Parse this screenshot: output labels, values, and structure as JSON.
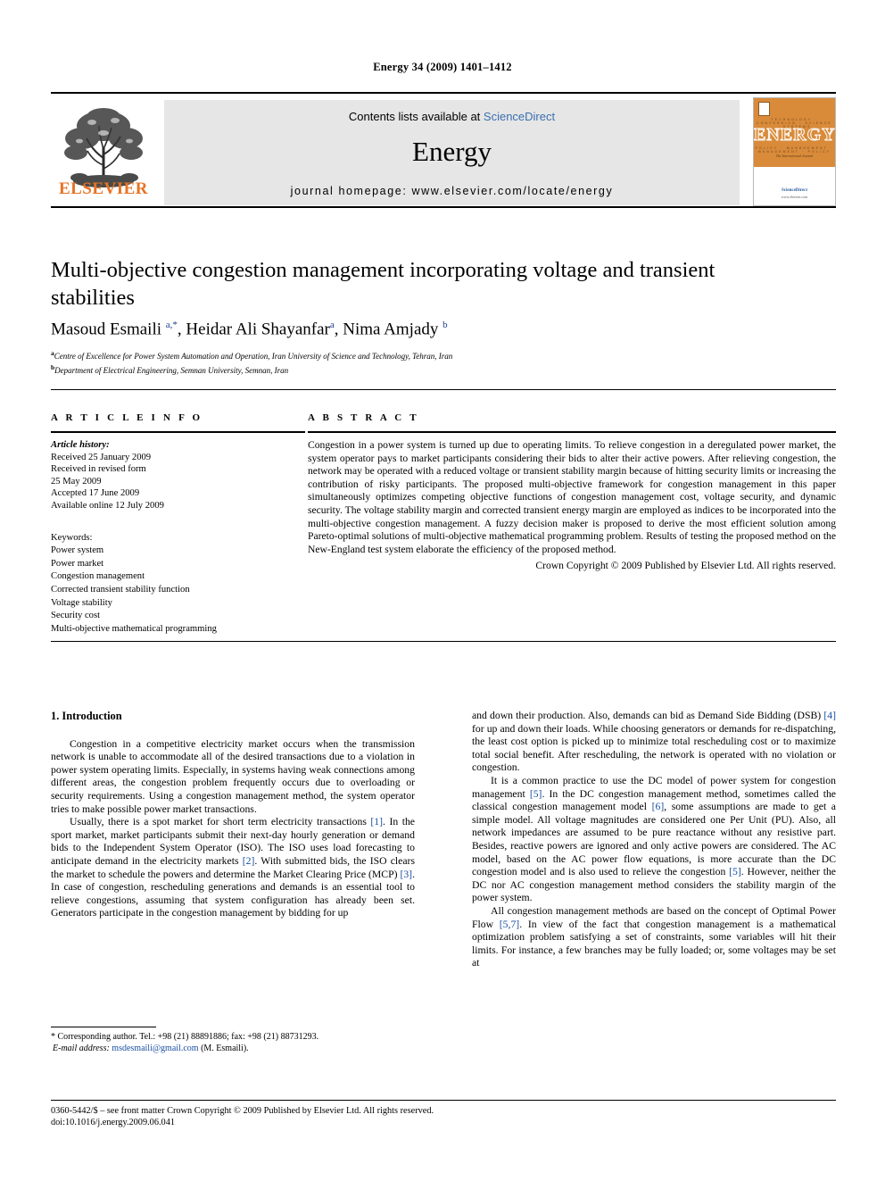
{
  "running_head": "Energy 34 (2009) 1401–1412",
  "masthead": {
    "publisher_name": "ELSEVIER",
    "contents_prefix": "Contents lists available at ",
    "sciencedirect": "ScienceDirect",
    "journal_name": "Energy",
    "homepage": "journal homepage: www.elsevier.com/locate/energy",
    "cover": {
      "title": "ENERGY",
      "row_top": "TECHNOLOGY · CONVERSION · SCIENCE · SYSTEMS",
      "row_bottom": "POLICY · MANAGEMENT · MANAGEMENT · POLICY",
      "subtitle": "The International Journal",
      "available_at": "Available online at",
      "sd_mark": "ScienceDirect",
      "url": "www.elsevier.com"
    }
  },
  "article": {
    "title": "Multi-objective congestion management incorporating voltage and transient stabilities",
    "authors_html": "Masoud Esmaili <sup>a,*</sup>, Heidar Ali Shayanfar<sup>a</sup>, Nima Amjady <sup>b</sup>",
    "affiliations": [
      {
        "marker": "a",
        "text": "Centre of Excellence for Power System Automation and Operation, Iran University of Science and Technology, Tehran, Iran"
      },
      {
        "marker": "b",
        "text": "Department of Electrical Engineering, Semnan University, Semnan, Iran"
      }
    ]
  },
  "article_info": {
    "section_label": "A R T I C L E   I N F O",
    "history_label": "Article history:",
    "history": [
      "Received 25 January 2009",
      "Received in revised form",
      "25 May 2009",
      "Accepted 17 June 2009",
      "Available online 12 July 2009"
    ],
    "keywords_label": "Keywords:",
    "keywords": [
      "Power system",
      "Power market",
      "Congestion management",
      "Corrected transient stability function",
      "Voltage stability",
      "Security cost",
      "Multi-objective mathematical programming"
    ]
  },
  "abstract": {
    "section_label": "A B S T R A C T",
    "text": "Congestion in a power system is turned up due to operating limits. To relieve congestion in a deregulated power market, the system operator pays to market participants considering their bids to alter their active powers. After relieving congestion, the network may be operated with a reduced voltage or transient stability margin because of hitting security limits or increasing the contribution of risky participants. The proposed multi-objective framework for congestion management in this paper simultaneously optimizes competing objective functions of congestion management cost, voltage security, and dynamic security. The voltage stability margin and corrected transient energy margin are employed as indices to be incorporated into the multi-objective congestion management. A fuzzy decision maker is proposed to derive the most efficient solution among Pareto-optimal solutions of multi-objective mathematical programming problem. Results of testing the proposed method on the New-England test system elaborate the efficiency of the proposed method.",
    "copyright": "Crown Copyright © 2009 Published by Elsevier Ltd. All rights reserved."
  },
  "introduction": {
    "heading": "1.  Introduction",
    "left_paragraphs": [
      "Congestion in a competitive electricity market occurs when the transmission network is unable to accommodate all of the desired transactions due to a violation in power system operating limits. Especially, in systems having weak connections among different areas, the congestion problem frequently occurs due to overloading or security requirements. Using a congestion management method, the system operator tries to make possible power market transactions.",
      "Usually, there is a spot market for short term electricity transactions [1]. In the sport market, market participants submit their next-day hourly generation or demand bids to the Independent System Operator (ISO). The ISO uses load forecasting to anticipate demand in the electricity markets [2]. With submitted bids, the ISO clears the market to schedule the powers and determine the Market Clearing Price (MCP) [3]. In case of congestion, rescheduling generations and demands is an essential tool to relieve congestions, assuming that system configuration has already been set. Generators participate in the congestion management by bidding for up"
    ],
    "right_paragraphs": [
      "and down their production. Also, demands can bid as Demand Side Bidding (DSB) [4] for up and down their loads. While choosing generators or demands for re-dispatching, the least cost option is picked up to minimize total rescheduling cost or to maximize total social benefit. After rescheduling, the network is operated with no violation or congestion.",
      "It is a common practice to use the DC model of power system for congestion management [5]. In the DC congestion management method, sometimes called the classical congestion management model [6], some assumptions are made to get a simple model. All voltage magnitudes are considered one Per Unit (PU). Also, all network impedances are assumed to be pure reactance without any resistive part. Besides, reactive powers are ignored and only active powers are considered. The AC model, based on the AC power flow equations, is more accurate than the DC congestion model and is also used to relieve the congestion [5]. However, neither the DC nor AC congestion management method considers the stability margin of the power system.",
      "All congestion management methods are based on the concept of Optimal Power Flow [5,7]. In view of the fact that congestion management is a mathematical optimization problem satisfying a set of constraints, some variables will hit their limits. For instance, a few branches may be fully loaded; or, some voltages may be set at"
    ]
  },
  "footnote": {
    "corresponding": "* Corresponding author. Tel.: +98 (21) 88891886; fax: +98 (21) 88731293.",
    "email_label": "E-mail address:",
    "email": "msdesmaili@gmail.com",
    "email_suffix": "(M. Esmaili)."
  },
  "footer": {
    "front_matter": "0360-5442/$ – see front matter Crown Copyright © 2009 Published by Elsevier Ltd. All rights reserved.",
    "doi": "doi:10.1016/j.energy.2009.06.041"
  },
  "colors": {
    "elsevier_orange": "#e87324",
    "link_blue": "#3a6fb0",
    "ref_blue": "#1a4fa0",
    "banner_gray": "#e6e6e6",
    "cover_orange": "#d98b3a"
  }
}
